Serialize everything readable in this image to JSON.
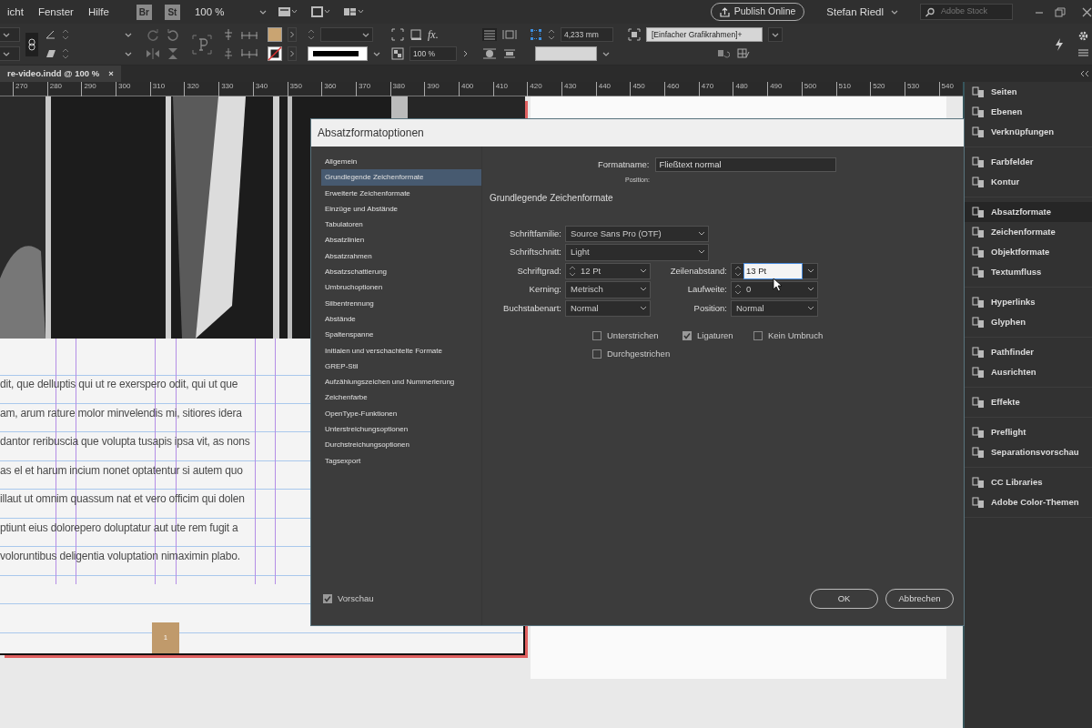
{
  "menu_bar": {
    "menus": [
      "icht",
      "Fenster",
      "Hilfe"
    ],
    "app_badges": [
      "Br",
      "St"
    ],
    "zoom": "100 %",
    "publish_button": "Publish Online",
    "user": "Stefan Riedl",
    "search": {
      "placeholder": "Adobe Stock"
    }
  },
  "control_bar": {
    "fx_label": "fx.",
    "opacity": "100 %",
    "spacing": "4,233 mm",
    "object_style": "[Einfacher Grafikrahmen]+"
  },
  "document_tab": {
    "title": "re-video.indd @ 100 %",
    "close": "×"
  },
  "ruler": {
    "ticks": [
      "270",
      "280",
      "290",
      "300",
      "310",
      "320",
      "330",
      "340",
      "350",
      "360",
      "370",
      "380",
      "390",
      "400",
      "410",
      "420",
      "430",
      "440",
      "450",
      "460",
      "470",
      "480",
      "490",
      "500",
      "510",
      "520",
      "530",
      "540"
    ]
  },
  "document": {
    "lines": [
      "dit, que delluptis qui ut re exerspero odit, qui ut que",
      "am, arum rature molor minvelendis mi, sitiores idera",
      "dantor reribuscia que volupta tusapis ipsa vit, as nons",
      "as el et harum incium nonet optatentur si autem quo",
      "illaut ut omnim quassum nat et vero officim qui dolen",
      "ptiunt eius dolorepero doluptatur aut ute rem fugit a",
      "voloruntibus deligentia voluptation nimaximin plabo."
    ],
    "page_number": "1"
  },
  "dialog": {
    "title": "Absatzformatoptionen",
    "categories": [
      {
        "label": "Allgemein",
        "selected": false
      },
      {
        "label": "Grundlegende Zeichenformate",
        "selected": true
      },
      {
        "label": "Erweiterte Zeichenformate",
        "selected": false
      },
      {
        "label": "Einzüge und Abstände",
        "selected": false
      },
      {
        "label": "Tabulatoren",
        "selected": false
      },
      {
        "label": "Absatzlinien",
        "selected": false
      },
      {
        "label": "Absatzrahmen",
        "selected": false
      },
      {
        "label": "Absatzschattierung",
        "selected": false
      },
      {
        "label": "Umbruchoptionen",
        "selected": false
      },
      {
        "label": "Silbentrennung",
        "selected": false
      },
      {
        "label": "Abstände",
        "selected": false
      },
      {
        "label": "Spaltenspanne",
        "selected": false
      },
      {
        "label": "Initialen und verschachtelte Formate",
        "selected": false
      },
      {
        "label": "GREP-Stil",
        "selected": false
      },
      {
        "label": "Aufzählungszeichen und Nummerierung",
        "selected": false
      },
      {
        "label": "Zeichenfarbe",
        "selected": false
      },
      {
        "label": "OpenType-Funktionen",
        "selected": false
      },
      {
        "label": "Unterstreichungsoptionen",
        "selected": false
      },
      {
        "label": "Durchstreichungsoptionen",
        "selected": false
      },
      {
        "label": "Tagsexport",
        "selected": false
      }
    ],
    "format_name_label": "Formatname:",
    "format_name": "Fließtext normal",
    "position_label": "Position:",
    "section_title": "Grundlegende Zeichenformate",
    "fields": [
      {
        "label": "Schriftfamilie:",
        "value": "Source Sans Pro (OTF)",
        "kind": "wide-select",
        "focused": false
      },
      {
        "label": "Schriftschnitt:",
        "value": "Light",
        "kind": "wide-select",
        "focused": false
      },
      {
        "label": "Schriftgrad:",
        "value": "12 Pt",
        "kind": "spin-select",
        "focused": false
      },
      {
        "label": "Zeilenabstand:",
        "value": "13 Pt",
        "kind": "spin-select",
        "focused": true
      },
      {
        "label": "Kerning:",
        "value": "Metrisch",
        "kind": "select",
        "focused": false
      },
      {
        "label": "Laufweite:",
        "value": "0",
        "kind": "spin-select",
        "focused": false
      },
      {
        "label": "Buchstabenart:",
        "value": "Normal",
        "kind": "select",
        "focused": false
      },
      {
        "label": "Position:",
        "value": "Normal",
        "kind": "select",
        "focused": false
      }
    ],
    "checkboxes": [
      {
        "label": "Unterstrichen",
        "checked": false
      },
      {
        "label": "Ligaturen",
        "checked": true
      },
      {
        "label": "Kein Umbruch",
        "checked": false
      },
      {
        "label": "Durchgestrichen",
        "checked": false
      }
    ],
    "preview": {
      "label": "Vorschau",
      "checked": true
    },
    "buttons": [
      "OK",
      "Abbrechen"
    ]
  },
  "panels": {
    "groups": [
      {
        "items": [
          {
            "label": "Seiten",
            "selected": false
          },
          {
            "label": "Ebenen",
            "selected": false
          },
          {
            "label": "Verknüpfungen",
            "selected": false
          }
        ]
      },
      {
        "items": [
          {
            "label": "Farbfelder",
            "selected": false
          },
          {
            "label": "Kontur",
            "selected": false
          }
        ]
      },
      {
        "items": [
          {
            "label": "Absatzformate",
            "selected": true
          },
          {
            "label": "Zeichenformate",
            "selected": false
          },
          {
            "label": "Objektformate",
            "selected": false
          },
          {
            "label": "Textumfluss",
            "selected": false
          }
        ]
      },
      {
        "items": [
          {
            "label": "Hyperlinks",
            "selected": false
          },
          {
            "label": "Glyphen",
            "selected": false
          }
        ]
      },
      {
        "items": [
          {
            "label": "Pathfinder",
            "selected": false
          },
          {
            "label": "Ausrichten",
            "selected": false
          }
        ]
      },
      {
        "items": [
          {
            "label": "Effekte",
            "selected": false
          }
        ]
      },
      {
        "items": [
          {
            "label": "Preflight",
            "selected": false
          },
          {
            "label": "Separationsvorschau",
            "selected": false
          }
        ]
      },
      {
        "items": [
          {
            "label": "CC Libraries",
            "selected": false
          },
          {
            "label": "Adobe Color-Themen",
            "selected": false
          }
        ]
      }
    ]
  }
}
